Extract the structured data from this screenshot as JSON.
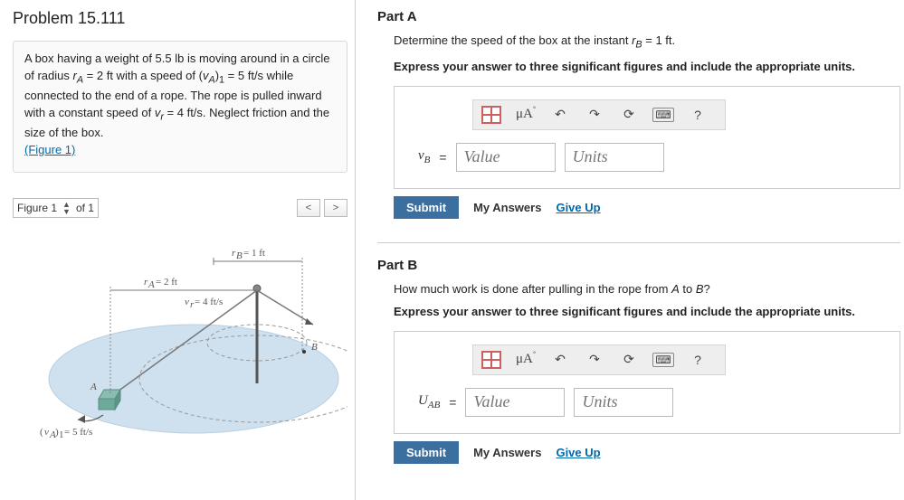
{
  "problem": {
    "title": "Problem 15.111",
    "statement_html": "A box having a weight of 5.5 lb is moving around in a circle of radius rₐ = 2 ft with a speed of (vₐ)₁ = 5 ft/s while connected to the end of a rope. The rope is pulled inward with a constant speed of vᵣ = 4 ft/s. Neglect friction and the size of the box.",
    "figure_link": "(Figure 1)"
  },
  "figure_bar": {
    "label": "Figure 1",
    "of_label": "of 1",
    "prev": "<",
    "next": ">"
  },
  "figure_labels": {
    "rb": "r_B = 1 ft",
    "ra": "r_A = 2 ft",
    "vr": "v_r = 4 ft/s",
    "va1": "(v_A)_1 = 5 ft/s",
    "A": "A",
    "B": "B"
  },
  "toolbar": {
    "mu": "μA",
    "undo": "↶",
    "redo": "↷",
    "reset": "⟳",
    "keyboard": "⌨",
    "help": "?"
  },
  "partA": {
    "title": "Part A",
    "question": "Determine the speed of the box at the instant r_B = 1 ft.",
    "instruction": "Express your answer to three significant figures and include the appropriate units.",
    "var_label": "v_B",
    "value_ph": "Value",
    "units_ph": "Units",
    "submit": "Submit",
    "my_answers": "My Answers",
    "give_up": "Give Up"
  },
  "partB": {
    "title": "Part B",
    "question": "How much work is done after pulling in the rope from A to B?",
    "instruction": "Express your answer to three significant figures and include the appropriate units.",
    "var_label": "U_{AB}",
    "value_ph": "Value",
    "units_ph": "Units",
    "submit": "Submit",
    "my_answers": "My Answers",
    "give_up": "Give Up"
  }
}
